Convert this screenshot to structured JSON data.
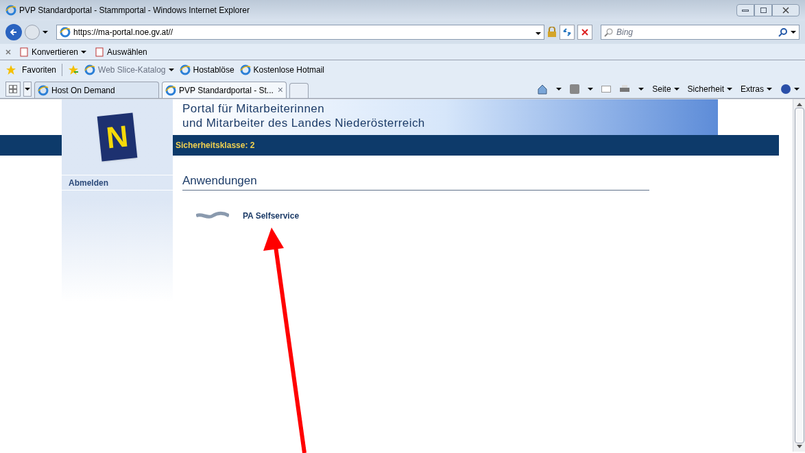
{
  "window": {
    "title": "PVP Standardportal - Stammportal - Windows Internet Explorer"
  },
  "address_bar": {
    "url": "https://ma-portal.noe.gv.at//"
  },
  "search": {
    "placeholder": "Bing"
  },
  "command_bar": {
    "items": [
      "Konvertieren",
      "Auswählen"
    ]
  },
  "favorites_bar": {
    "label": "Favoriten",
    "links": [
      {
        "label": "Web Slice-Katalog",
        "disabled": true,
        "dropdown": true
      },
      {
        "label": "Hostablöse",
        "disabled": false,
        "dropdown": false
      },
      {
        "label": "Kostenlose Hotmail",
        "disabled": false,
        "dropdown": false
      }
    ]
  },
  "tabs": [
    {
      "label": "Host On Demand",
      "selected": false
    },
    {
      "label": "PVP Standardportal - St...",
      "selected": true,
      "close": "×"
    }
  ],
  "tools": [
    "Seite",
    "Sicherheit",
    "Extras"
  ],
  "page": {
    "logo_letter": "N",
    "header_lines": [
      "Portal für Mitarbeiterinnen",
      "und Mitarbeiter des Landes Niederösterreich"
    ],
    "security_class": "Sicherheitsklasse: 2",
    "sidebar": [
      "Abmelden"
    ],
    "section_title": "Anwendungen",
    "applications": [
      "PA Selfservice"
    ]
  }
}
